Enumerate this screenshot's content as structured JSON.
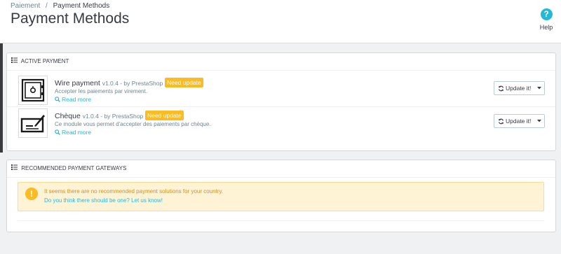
{
  "breadcrumb": {
    "parent": "Paiement",
    "separator": "/",
    "current": "Payment Methods"
  },
  "page_title": "Payment Methods",
  "help": {
    "label": "Help",
    "icon": "question-circle-icon",
    "glyph": "?"
  },
  "colors": {
    "accent": "#25b9d7",
    "warning": "#fbbb22",
    "alert_bg": "#fff3d6"
  },
  "active_payment": {
    "heading": "ACTIVE PAYMENT",
    "modules": [
      {
        "name": "Wire payment",
        "version": "v1.0.4 - by PrestaShop",
        "badge": "Need update",
        "description": "Accepter les paiements par virement.",
        "read_more": "Read more",
        "button": "Update it!",
        "logo_icon": "safe-icon"
      },
      {
        "name": "Chèque",
        "version": "v1.0.4 - by PrestaShop",
        "badge": "Need update",
        "description": "Ce module vous permet d'accepter des paiements par chèque.",
        "read_more": "Read more",
        "button": "Update it!",
        "logo_icon": "cheque-icon"
      }
    ]
  },
  "recommended": {
    "heading": "RECOMMENDED PAYMENT GATEWAYS",
    "alert_icon_glyph": "!",
    "alert_text": "It seems there are no recommended payment solutions for your country.",
    "alert_link": "Do you think there should be one? Let us know!"
  }
}
